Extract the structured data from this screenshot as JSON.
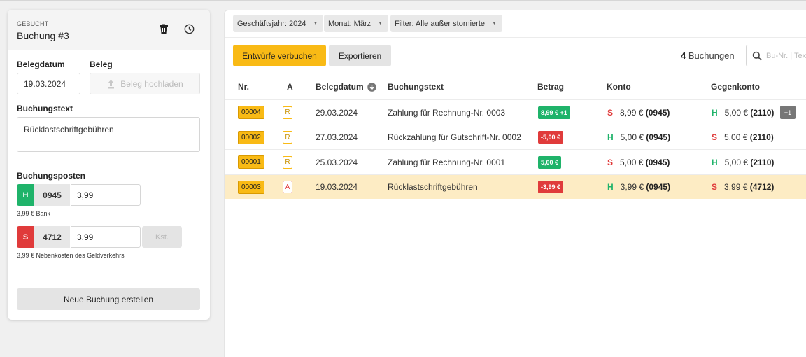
{
  "colors": {
    "accent": "#f9ba15",
    "haben": "#1fb36a",
    "soll": "#e03b3b",
    "selected_row": "#fdecc4"
  },
  "left": {
    "status": "GEBUCHT",
    "title": "Buchung #3",
    "icons": {
      "delete": "trash-icon",
      "history": "clock-icon"
    },
    "belegdatum_label": "Belegdatum",
    "belegdatum_value": "19.03.2024",
    "beleg_label": "Beleg",
    "upload_label": "Beleg hochladen",
    "buchungstext_label": "Buchungstext",
    "buchungstext_value": "Rücklastschriftgebühren",
    "posten_label": "Buchungsposten",
    "posten": [
      {
        "side": "H",
        "account": "0945",
        "amount": "3,99",
        "hint": "3,99 € Bank"
      },
      {
        "side": "S",
        "account": "4712",
        "amount": "3,99",
        "hint": "3,99 € Nebenkosten des Geldverkehrs",
        "kst": "Kst."
      }
    ],
    "new_button": "Neue Buchung erstellen"
  },
  "filters": [
    "Geschäftsjahr: 2024",
    "Monat: März",
    "Filter: Alle außer stornierte"
  ],
  "actions": {
    "primary": "Entwürfe verbuchen",
    "secondary": "Exportieren"
  },
  "count": {
    "number": "4",
    "label": "Buchungen"
  },
  "search": {
    "placeholder": "Bu-Nr. | Text"
  },
  "columns": [
    "Nr.",
    "A",
    "Belegdatum",
    "Buchungstext",
    "Betrag",
    "Konto",
    "Gegenkonto"
  ],
  "rows": [
    {
      "nr": "00004",
      "a": "R",
      "date": "29.03.2024",
      "text": "Zahlung für Rechnung-Nr. 0003",
      "amount": "8,99 € +1",
      "amount_color": "#1fb36a",
      "konto_side": "S",
      "konto_amount": "8,99 €",
      "konto_acct": "(0945)",
      "gegen_side": "H",
      "gegen_amount": "5,00 €",
      "gegen_acct": "(2110)",
      "extra": "+1"
    },
    {
      "nr": "00002",
      "a": "R",
      "date": "27.03.2024",
      "text": "Rückzahlung für Gutschrift-Nr. 0002",
      "amount": "-5,00 €",
      "amount_color": "#e03b3b",
      "konto_side": "H",
      "konto_amount": "5,00 €",
      "konto_acct": "(0945)",
      "gegen_side": "S",
      "gegen_amount": "5,00 €",
      "gegen_acct": "(2110)",
      "extra": ""
    },
    {
      "nr": "00001",
      "a": "R",
      "date": "25.03.2024",
      "text": "Zahlung für Rechnung-Nr. 0001",
      "amount": "5,00 €",
      "amount_color": "#1fb36a",
      "konto_side": "S",
      "konto_amount": "5,00 €",
      "konto_acct": "(0945)",
      "gegen_side": "H",
      "gegen_amount": "5,00 €",
      "gegen_acct": "(2110)",
      "extra": ""
    },
    {
      "nr": "00003",
      "a": "A",
      "date": "19.03.2024",
      "text": "Rücklastschriftgebühren",
      "amount": "-3,99 €",
      "amount_color": "#e03b3b",
      "konto_side": "H",
      "konto_amount": "3,99 €",
      "konto_acct": "(0945)",
      "gegen_side": "S",
      "gegen_amount": "3,99 €",
      "gegen_acct": "(4712)",
      "extra": "",
      "selected": true
    }
  ]
}
